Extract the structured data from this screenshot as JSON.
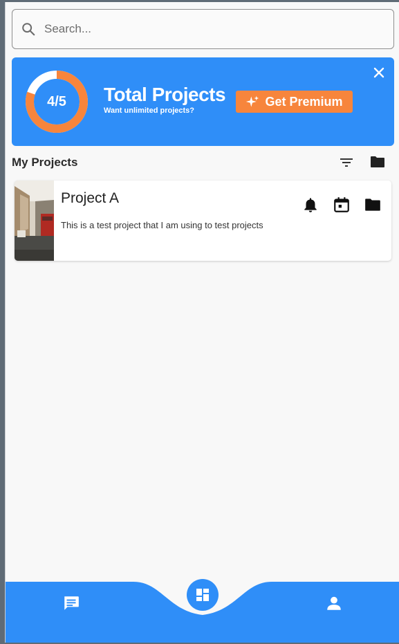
{
  "search": {
    "placeholder": "Search..."
  },
  "banner": {
    "progress_label": "4/5",
    "progress_fraction": 0.8,
    "title": "Total Projects",
    "subtitle": "Want unlimited projects?",
    "premium_label": "Get Premium"
  },
  "section": {
    "title": "My Projects"
  },
  "projects": [
    {
      "title": "Project A",
      "description": "This is a test project that I am using to test projects"
    }
  ],
  "colors": {
    "primary": "#2f8ef8",
    "accent": "#f7853c",
    "background": "#f8f8f8"
  },
  "icons": {
    "search": "search-icon",
    "close": "close-icon",
    "sparkle": "sparkle-icon",
    "filter": "filter-icon",
    "folder": "folder-icon",
    "bell": "bell-icon",
    "calendar": "calendar-icon",
    "chat": "chat-icon",
    "dashboard": "dashboard-icon",
    "profile": "profile-icon"
  }
}
